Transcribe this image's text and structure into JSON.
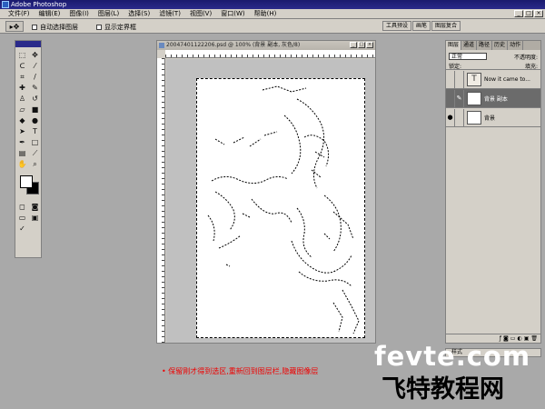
{
  "app": {
    "title": "Adobe Photoshop",
    "menu": [
      "文件(F)",
      "编辑(E)",
      "图像(I)",
      "图层(L)",
      "选择(S)",
      "滤镜(T)",
      "视图(V)",
      "窗口(W)",
      "帮助(H)"
    ]
  },
  "options": {
    "auto_select": "自动选择图层",
    "show_bounds": "显示定界框"
  },
  "palette_well": [
    "工具预设",
    "画笔",
    "图层复合"
  ],
  "document": {
    "title": "20047401122206.psd @ 100% (背景 副本, 灰色/8)"
  },
  "layers": {
    "tabs": [
      "图层",
      "通道",
      "路径",
      "历史",
      "动作"
    ],
    "blend_mode": "正常",
    "opacity_label": "不透明度:",
    "lock_label": "锁定:",
    "fill_label": "填充:",
    "items": [
      {
        "name": "Now it came to...",
        "thumb": "T"
      },
      {
        "name": "背景 副本"
      },
      {
        "name": "背景"
      }
    ]
  },
  "styles_tab": "样式",
  "caption": "• 保留刚才得到选区,重新回到图层栏,隐藏图像层",
  "watermark": {
    "en": "fevte.com",
    "cn": "飞特教程网"
  }
}
